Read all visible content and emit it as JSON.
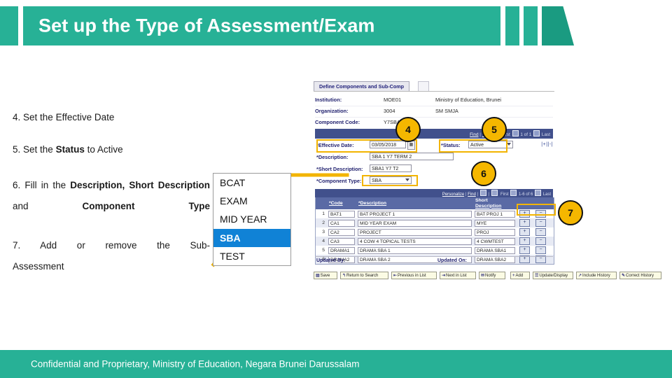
{
  "slide": {
    "title": "Set up the Type of Assessment/Exam",
    "footer": "Confidential and Proprietary, Ministry of Education, Negara Brunei Darussalam",
    "accent_green": "#27b196",
    "accent_green_dark": "#1a9b81",
    "badge_color": "#f5b700",
    "highlight_color": "#f2b400"
  },
  "steps": {
    "s4_num": "4.",
    "s4_a": "Set the Effective Date",
    "s5_num": "5.",
    "s5_a": "Set the ",
    "s5_b": "Status",
    "s5_c": " to Active",
    "s6_num": "6.",
    "s6_a": "Fill in the ",
    "s6_b": "Description, Short Description",
    "s6_c": " and ",
    "s6_d": "Component Type",
    "s7_num": "7.",
    "s7_a": "Add or remove the Sub-",
    "s7_b": "Assessment"
  },
  "badges": [
    {
      "label": "4"
    },
    {
      "label": "5"
    },
    {
      "label": "6"
    },
    {
      "label": "7"
    }
  ],
  "dropdown_options": [
    {
      "label": "BCAT",
      "selected": false
    },
    {
      "label": "EXAM",
      "selected": false
    },
    {
      "label": "MID YEAR",
      "selected": false
    },
    {
      "label": "SBA",
      "selected": true
    },
    {
      "label": "TEST",
      "selected": false
    }
  ],
  "app": {
    "tab_label": "Define Components and Sub-Comp",
    "info_rows": [
      {
        "label": "Institution:",
        "value1": "MOE01",
        "value2": "Ministry of Education, Brunei"
      },
      {
        "label": "Organization:",
        "value1": "3004",
        "value2": "SM SMJA"
      },
      {
        "label": "Component Code:",
        "value1": "Y7SBA1",
        "value2": ""
      }
    ],
    "nav_find": "Find",
    "nav_view_all": "View All",
    "nav_first": "First",
    "nav_count": "1 of 1",
    "nav_last": "Last",
    "effective_date_label": "*Effective Date:",
    "effective_date_value": "03/05/2018",
    "status_label": "*Status:",
    "status_value": "Active",
    "row_plusminus": "|+||-|",
    "description_label": "*Description:",
    "description_value": "SBA 1 Y7 TERM 2",
    "short_description_label": "*Short Description:",
    "short_description_value": "SBA1 Y7 T2",
    "component_type_label": "*Component Type:",
    "component_type_value": "SBA",
    "grid_nav_personalize": "Personalize",
    "grid_nav_find": "Find",
    "grid_nav_first": "First",
    "grid_nav_count": "1-6 of 6",
    "grid_nav_last": "Last",
    "grid_headers": {
      "num": "",
      "code": "*Code",
      "description": "*Description",
      "short_description_l1": "Short",
      "short_description_l2": "Description",
      "add": "",
      "remove": ""
    },
    "grid_rows": [
      {
        "num": "1",
        "code": "BAT1",
        "description": "BAT PROJECT 1",
        "short_description": "BAT PROJ 1",
        "add": "+",
        "remove": "−"
      },
      {
        "num": "2",
        "code": "CA1",
        "description": "MID YEAR EXAM",
        "short_description": "MYE",
        "add": "+",
        "remove": "−"
      },
      {
        "num": "3",
        "code": "CA2",
        "description": "PROJECT",
        "short_description": "PROJ",
        "add": "+",
        "remove": "−"
      },
      {
        "num": "4",
        "code": "CA3",
        "description": "4 COW 4 TOPICAL TESTS",
        "short_description": "4 CWMTEST",
        "add": "+",
        "remove": "−"
      },
      {
        "num": "5",
        "code": "DRAMA1",
        "description": "DRAMA SBA 1",
        "short_description": "DRAMA SBA1",
        "add": "+",
        "remove": "−"
      },
      {
        "num": "6",
        "code": "DRAMA2",
        "description": "DRAMA SBA 2",
        "short_description": "DRAMA SBA2",
        "add": "+",
        "remove": "−"
      }
    ],
    "updated_by_label": "Updated By:",
    "updated_on_label": "Updated On:",
    "buttons": [
      {
        "label": "Save",
        "glyph": "▤"
      },
      {
        "label": "Return to Search",
        "glyph": "↰"
      },
      {
        "label": "Previous in List",
        "glyph": "⇤"
      },
      {
        "label": "Next in List",
        "glyph": "⇥"
      },
      {
        "label": "Notify",
        "glyph": "✉"
      },
      {
        "label": "Add",
        "glyph": "+"
      },
      {
        "label": "Update/Display",
        "glyph": "☰"
      },
      {
        "label": "Include History",
        "glyph": "↗"
      },
      {
        "label": "Correct History",
        "glyph": "✎"
      }
    ]
  }
}
